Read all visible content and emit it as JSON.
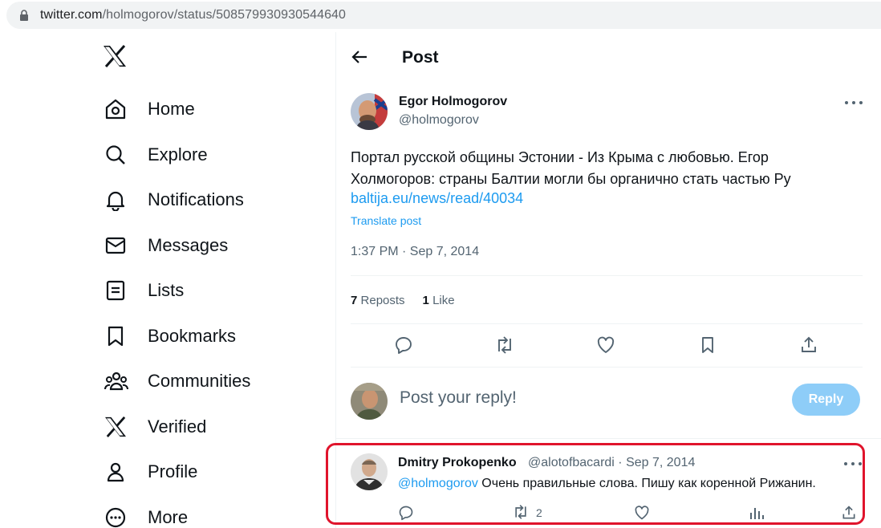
{
  "browser": {
    "url_host": "twitter.com",
    "url_path": "/holmogorov/status/508579930930544640"
  },
  "nav": {
    "items": [
      {
        "label": "Home",
        "icon": "home-icon"
      },
      {
        "label": "Explore",
        "icon": "search-icon"
      },
      {
        "label": "Notifications",
        "icon": "bell-icon"
      },
      {
        "label": "Messages",
        "icon": "envelope-icon"
      },
      {
        "label": "Lists",
        "icon": "list-icon"
      },
      {
        "label": "Bookmarks",
        "icon": "bookmark-icon"
      },
      {
        "label": "Communities",
        "icon": "people-icon"
      },
      {
        "label": "Verified",
        "icon": "x-logo-icon"
      },
      {
        "label": "Profile",
        "icon": "person-icon"
      },
      {
        "label": "More",
        "icon": "more-circle-icon"
      }
    ]
  },
  "header": {
    "title": "Post"
  },
  "tweet": {
    "author_name": "Egor Holmogorov",
    "author_handle": "@holmogorov",
    "text": "Портал русской общины Эстонии - Из Крыма с любовью. Егор Холмогоров: страны Балтии могли бы органично стать частью Ру",
    "link": "baltija.eu/news/read/40034",
    "translate": "Translate post",
    "timestamp": "1:37 PM · Sep 7, 2014",
    "reposts_count": "7",
    "reposts_label": "Reposts",
    "likes_count": "1",
    "likes_label": "Like"
  },
  "compose": {
    "placeholder": "Post your reply!",
    "button": "Reply"
  },
  "reply": {
    "name": "Dmitry Prokopenko",
    "meta": "@alotofbacardi · Sep 7, 2014",
    "mention": "@holmogorov",
    "text": " Очень правильные слова. Пишу как коренной Рижанин.",
    "retweets": "2"
  },
  "colors": {
    "accent": "#1d9bf0",
    "highlight_border": "#e0142c",
    "reply_button": "#8ecdf8"
  }
}
